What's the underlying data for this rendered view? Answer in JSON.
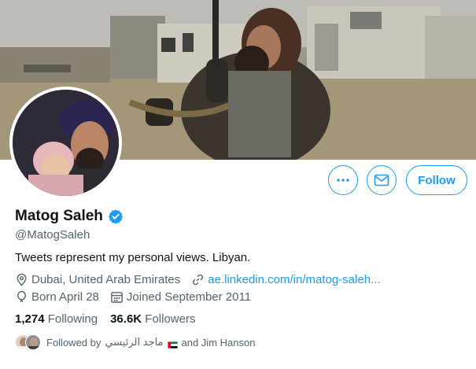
{
  "profile": {
    "name": "Matog Saleh",
    "handle": "@MatogSaleh",
    "bio": "Tweets represent my personal views. Libyan.",
    "location": "Dubai, United Arab Emirates",
    "website": "ae.linkedin.com/in/matog-saleh...",
    "birthday": "Born April 28",
    "joined": "Joined September 2011"
  },
  "stats": {
    "following_count": "1,274",
    "following_label": "Following",
    "followers_count": "36.6K",
    "followers_label": "Followers"
  },
  "actions": {
    "more_icon": "more-icon",
    "message_icon": "envelope-icon",
    "follow_label": "Follow"
  },
  "followed_by": {
    "prefix": "Followed by",
    "name1": "ماجد الرئيسي",
    "suffix": "and Jim Hanson"
  },
  "colors": {
    "accent": "#1d9bf0",
    "secondary_text": "#536471",
    "primary_text": "#0f1419",
    "verified": "#1d9bf0"
  },
  "icons": [
    "location-pin-icon",
    "link-icon",
    "balloon-icon",
    "calendar-icon",
    "verified-badge-icon",
    "uae-flag-icon"
  ]
}
